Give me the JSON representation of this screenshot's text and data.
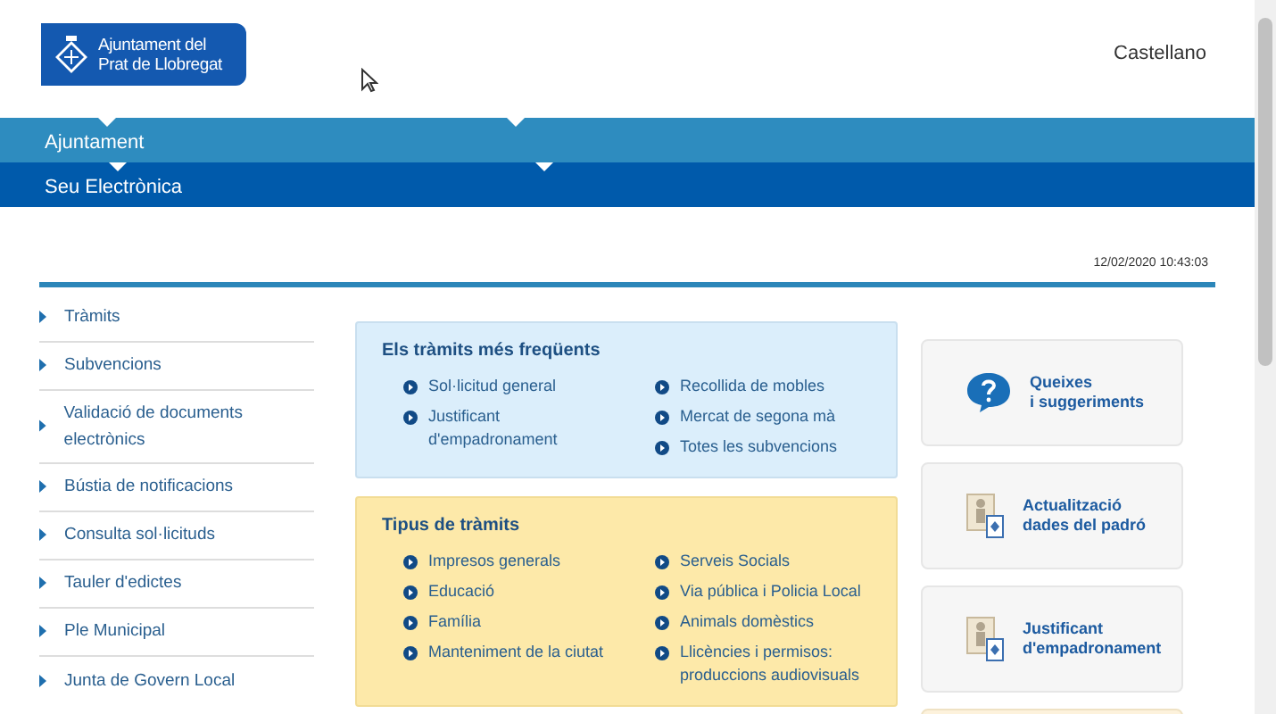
{
  "header": {
    "logo_text": [
      "Ajuntament del",
      "Prat de Llobregat"
    ],
    "language_link": "Castellano"
  },
  "nav": [
    {
      "label": "Ajuntament"
    },
    {
      "label": "Seu Electrònica"
    }
  ],
  "date_time": "12/02/2020 10:43:03",
  "sidebar": {
    "items": [
      {
        "label": "Tràmits"
      },
      {
        "label": "Subvencions"
      },
      {
        "label": "Validació de documents electrònics"
      },
      {
        "label": "Bústia de notificacions"
      },
      {
        "label": "Consulta sol·licituds"
      },
      {
        "label": "Tauler d'edictes"
      },
      {
        "label": "Ple Municipal"
      },
      {
        "label": "Junta de Govern Local"
      }
    ]
  },
  "panels": [
    {
      "kind": "frequent",
      "title": "Els tràmits més freqüents",
      "columns": [
        [
          "Sol·licitud general",
          "Justificant d'empadronament"
        ],
        [
          "Recollida de mobles",
          "Mercat de segona mà",
          "Totes les subvencions"
        ]
      ]
    },
    {
      "kind": "types",
      "title": "Tipus de tràmits",
      "columns": [
        [
          "Impresos generals",
          "Educació",
          "Família",
          "Manteniment de la ciutat"
        ],
        [
          "Serveis Socials",
          "Via pública i Policia Local",
          "Animals domèstics",
          "Llicències i permisos: produccions audiovisuals"
        ]
      ]
    }
  ],
  "cards": [
    {
      "kind": "question",
      "lines": [
        "Queixes",
        "i suggeriments"
      ]
    },
    {
      "kind": "document",
      "lines": [
        "Actualització",
        "dades del padró"
      ]
    },
    {
      "kind": "document",
      "lines": [
        "Justificant",
        "d'empadronament"
      ]
    }
  ]
}
